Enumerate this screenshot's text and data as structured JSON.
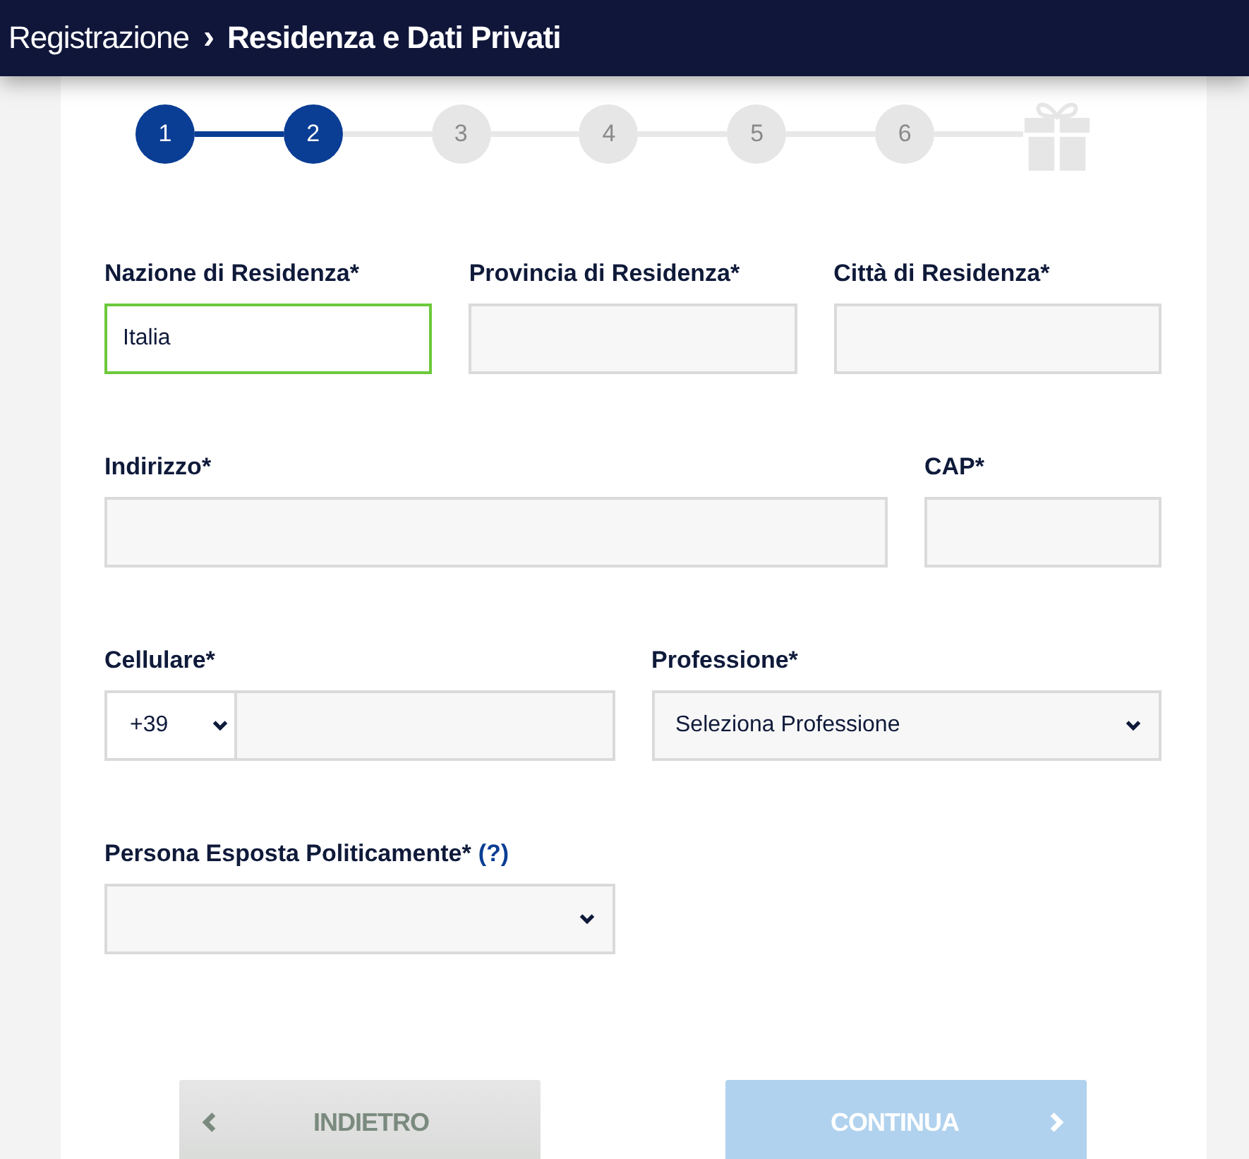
{
  "header": {
    "breadcrumb": "Registrazione",
    "separator": "›",
    "title": "Residenza e Dati Privati"
  },
  "steps": [
    {
      "label": "1",
      "completed": true
    },
    {
      "label": "2",
      "completed": true
    },
    {
      "label": "3",
      "completed": false
    },
    {
      "label": "4",
      "completed": false
    },
    {
      "label": "5",
      "completed": false
    },
    {
      "label": "6",
      "completed": false
    }
  ],
  "form_rows": [
    {
      "fields": [
        {
          "kind": "text",
          "label": "Nazione di Residenza*",
          "value": "Italia",
          "valid": true
        },
        {
          "kind": "text",
          "label": "Provincia di Residenza*",
          "valid": false
        },
        {
          "kind": "text",
          "label": "Città di Residenza*",
          "valid": false
        }
      ]
    },
    {
      "fields": [
        {
          "kind": "text",
          "label": "Indirizzo*",
          "valid": false
        },
        {
          "kind": "text",
          "label": "CAP*",
          "valid": false
        }
      ]
    },
    {
      "fields": [
        {
          "kind": "phone",
          "label": "Cellulare*",
          "prefix": "+39",
          "valid": false
        },
        {
          "kind": "select",
          "label": "Professione*",
          "value": "Seleziona Professione",
          "valid": false
        }
      ]
    },
    {
      "fields": [
        {
          "kind": "select",
          "label": "Persona Esposta Politicamente*",
          "help": "(?)",
          "valid": false
        }
      ]
    }
  ],
  "buttons": [
    {
      "kind": "back",
      "label": "INDIETRO",
      "disabled": false
    },
    {
      "kind": "next",
      "label": "CONTINUA",
      "disabled": true
    }
  ]
}
